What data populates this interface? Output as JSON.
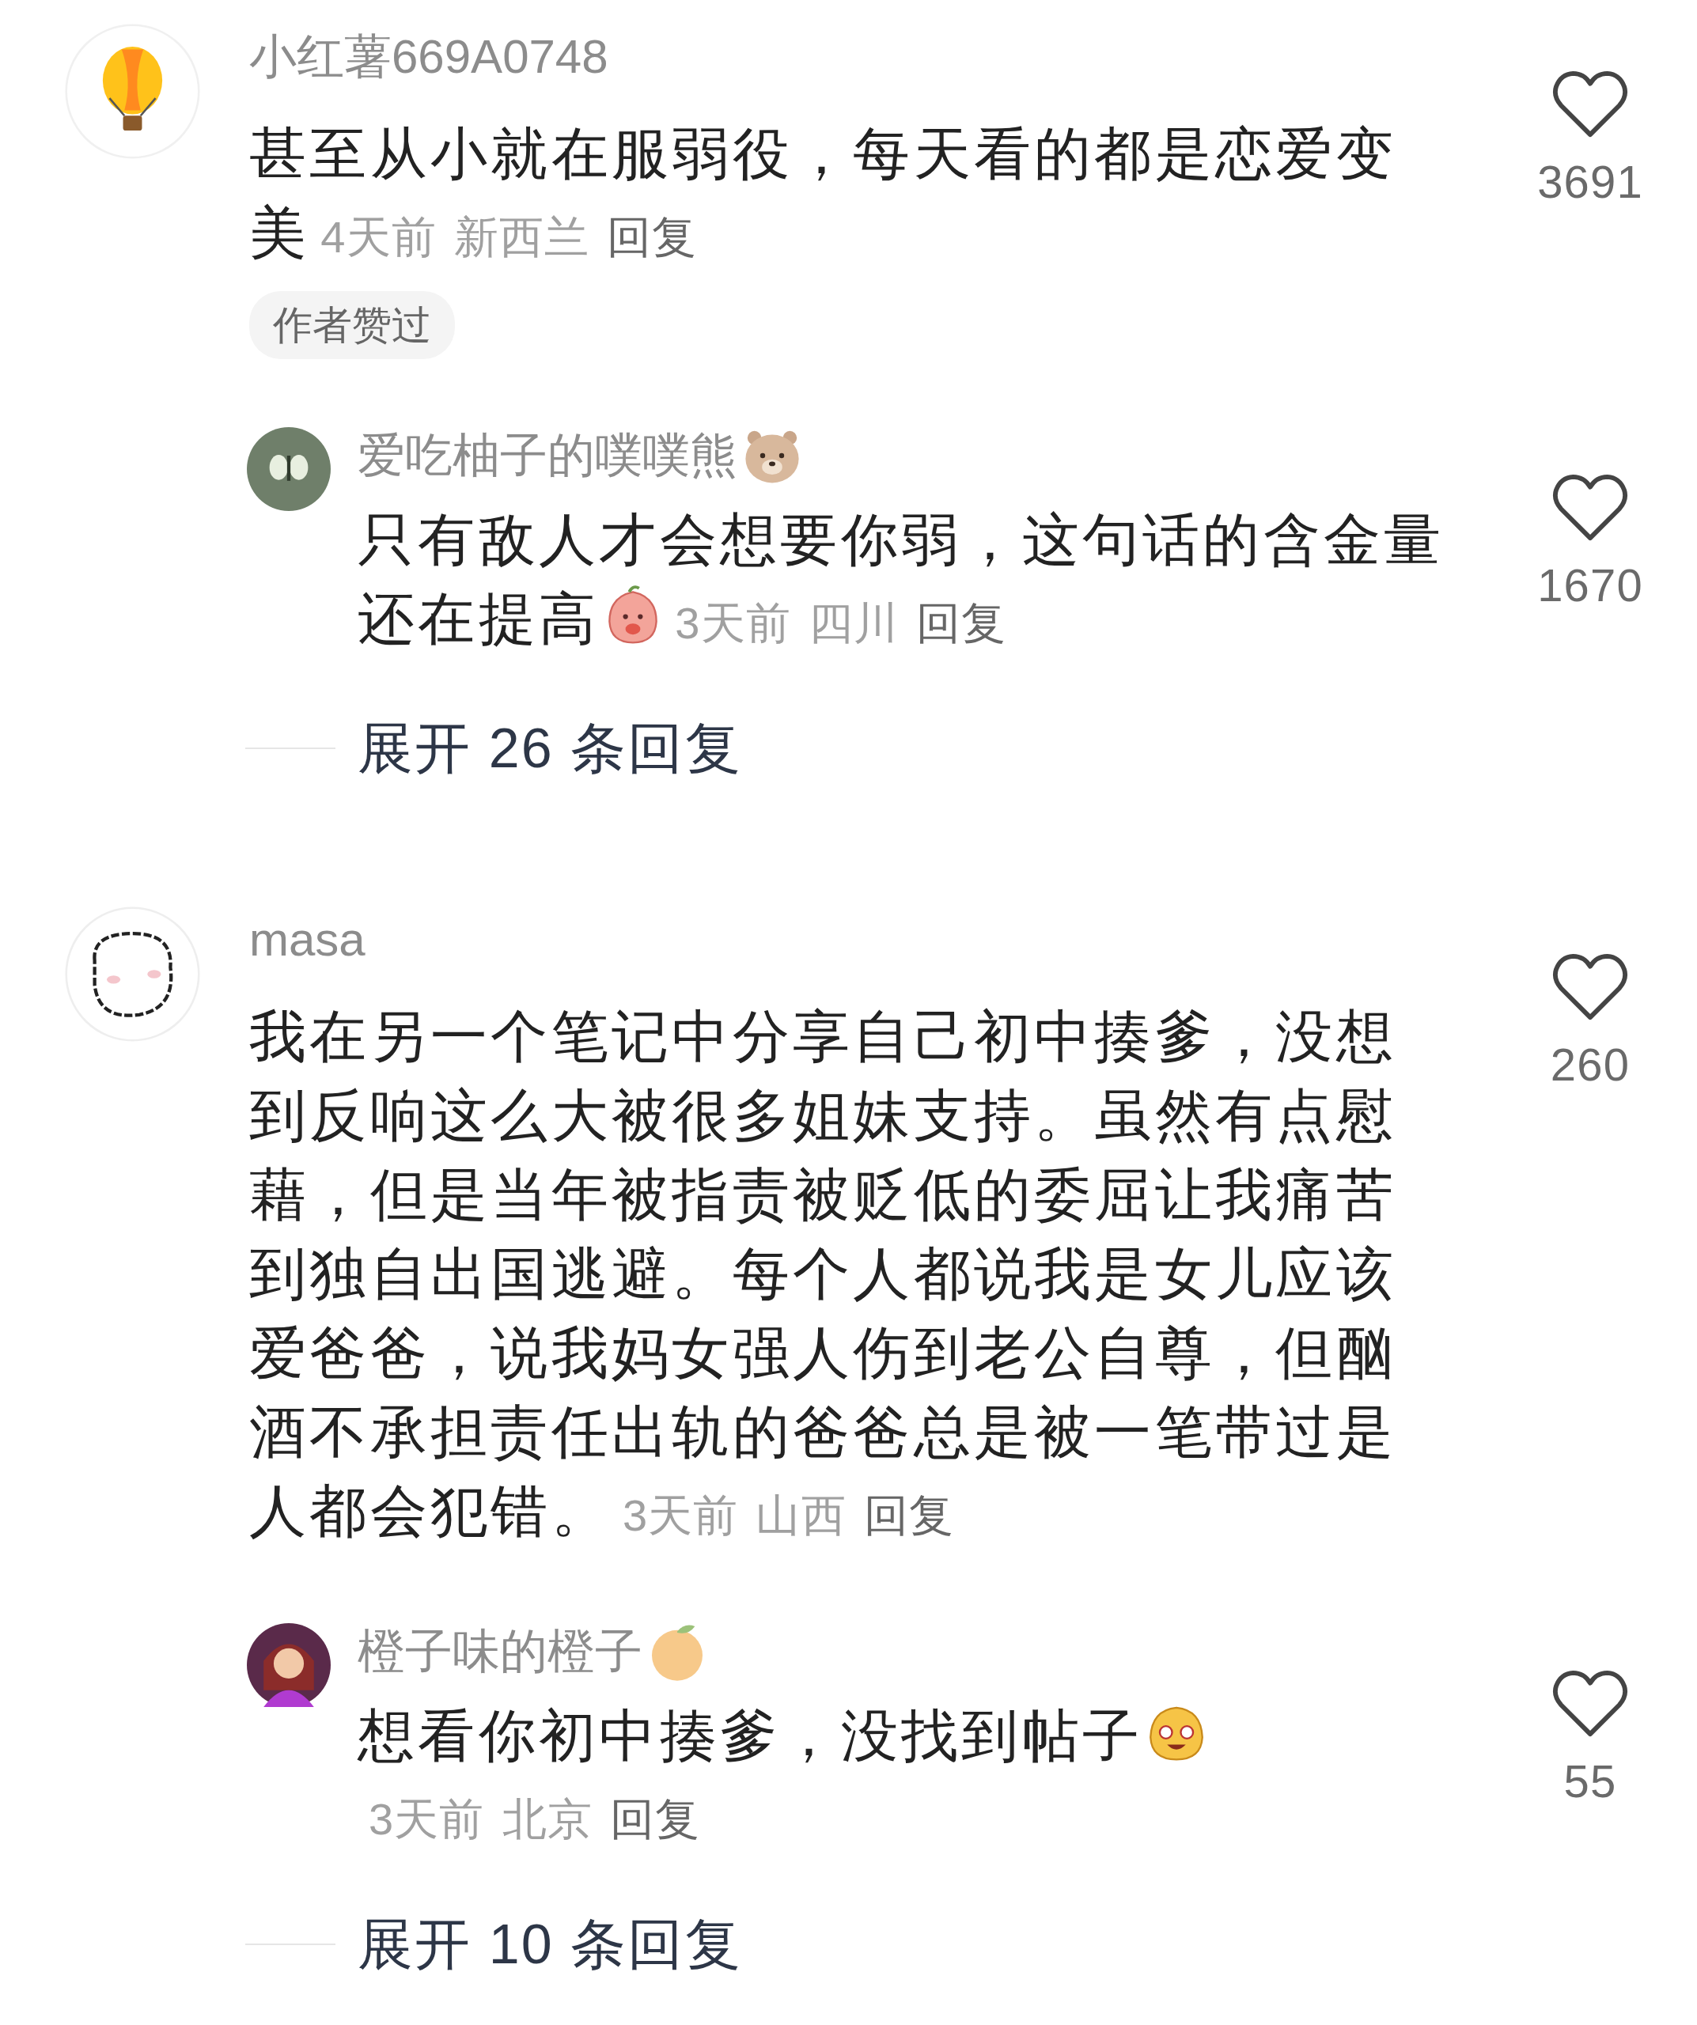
{
  "comments": [
    {
      "author": "小红薯669A0748",
      "avatar": {
        "kind": "balloon"
      },
      "text": "甚至从小就在服弱役，每天看的都是恋爱变美",
      "time": "4天前",
      "location": "新西兰",
      "reply": "回复",
      "badge": "作者赞过",
      "likes": "3691",
      "replies": [
        {
          "author": "爱吃柚子的噗噗熊",
          "avatar": {
            "kind": "butterfly"
          },
          "name_emoji": {
            "kind": "bear"
          },
          "text": "只有敌人才会想要你弱，这句话的含金量还在提高",
          "text_emoji": {
            "kind": "peach"
          },
          "time": "3天前",
          "location": "四川",
          "reply": "回复",
          "likes": "1670"
        }
      ],
      "expand": "展开 26 条回复"
    },
    {
      "author": "masa",
      "avatar": {
        "kind": "doodle"
      },
      "text": "我在另一个笔记中分享自己初中揍爹，没想到反响这么大被很多姐妹支持。虽然有点慰藉，但是当年被指责被贬低的委屈让我痛苦到独自出国逃避。每个人都说我是女儿应该爱爸爸，说我妈女强人伤到老公自尊，但酗酒不承担责任出轨的爸爸总是被一笔带过是人都会犯错。",
      "time": "3天前",
      "location": "山西",
      "reply": "回复",
      "likes": "260",
      "replies": [
        {
          "author": "橙子味的橙子",
          "avatar": {
            "kind": "figure"
          },
          "name_emoji": {
            "kind": "orange"
          },
          "text": "想看你初中揍爹，没找到帖子",
          "text_emoji": {
            "kind": "smiley"
          },
          "time": "3天前",
          "location": "北京",
          "reply": "回复",
          "likes": "55"
        }
      ],
      "expand": "展开 10 条回复"
    }
  ]
}
